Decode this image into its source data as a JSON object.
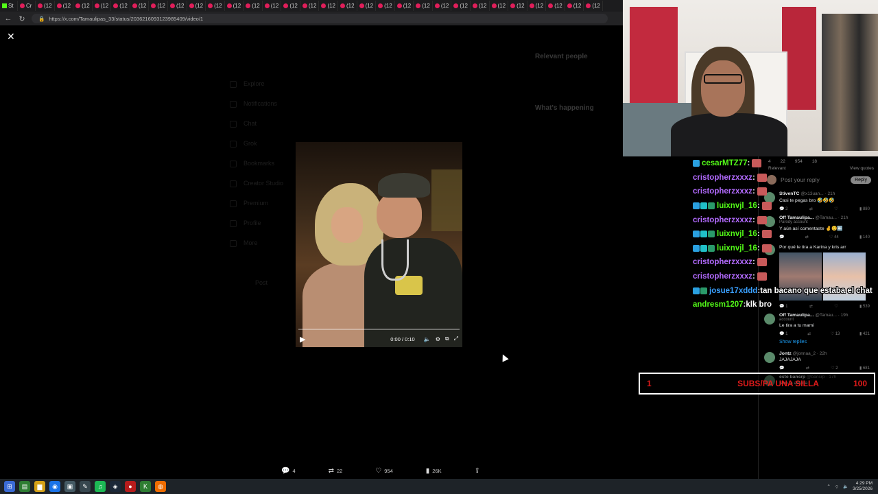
{
  "browser": {
    "tab_labels": [
      "St",
      "Cr",
      "(12",
      "(12",
      "(12",
      "(12",
      "(12",
      "(12",
      "(12",
      "(12",
      "(12",
      "(12",
      "(12",
      "(12",
      "(12",
      "(12",
      "(12",
      "(12",
      "(12",
      "(12",
      "(12",
      "(12",
      "(12",
      "(12",
      "(12",
      "(12",
      "(12",
      "(12",
      "(12",
      "(12",
      "(12",
      "(12"
    ],
    "url": "https://x.com/Tamaulipas_33/status/2036216093123985409/video/1"
  },
  "twitter_nav": {
    "items": [
      "Explore",
      "Notifications",
      "Chat",
      "Grok",
      "Bookmarks",
      "Creator Studio",
      "Premium",
      "Profile",
      "More"
    ],
    "post_button": "Post"
  },
  "video": {
    "time": "0:00 / 0:10"
  },
  "actions": {
    "replies": "4",
    "reposts": "22",
    "likes": "954",
    "views": "26K"
  },
  "replies_panel": {
    "top_stats": [
      "4",
      "22",
      "954",
      "18"
    ],
    "relevant": "Relevant",
    "view_quotes": "View quotes",
    "post_placeholder": "Post your reply",
    "reply_button": "Reply",
    "tweets": [
      {
        "name": "StivenTC",
        "handle": "@x13uan... · 21h",
        "sub": "",
        "text": "Casi te pegas bro 🤣🤣🤣",
        "stats": [
          "2",
          "",
          "",
          "880"
        ]
      },
      {
        "name": "Off Tamaulipa...",
        "handle": "@Tamau... · 21h",
        "sub": "Parody account",
        "text": "Y aún así comentaste ✌️😊⬅️",
        "stats": [
          "",
          "",
          "44",
          "140"
        ]
      },
      {
        "name": "",
        "handle": "",
        "sub": "",
        "text": "Por qué le tira a Karina y kris arr",
        "stats": [
          "1",
          "",
          "",
          "539"
        ],
        "media": true
      },
      {
        "name": "Off Tamaulipa...",
        "handle": "@Tamau... · 19h",
        "sub": "account",
        "text": "Le tira a tu mami",
        "stats": [
          "1",
          "",
          "13",
          "421"
        ]
      }
    ],
    "show_replies": "Show replies",
    "tweets2": [
      {
        "name": "Jontz",
        "handle": "@jonnaa_2 · 22h",
        "text": "JAJAJAJA",
        "stats": [
          "",
          "",
          "2",
          "681"
        ]
      },
      {
        "name": "este bansrp",
        "handle": "@bansrp · 17h",
        "text": "Noo la azulita",
        "stats": []
      }
    ]
  },
  "chat": [
    {
      "user": "cesarMTZ77",
      "color": "#53fc18",
      "badges": [
        "b-blue"
      ],
      "message": "",
      "emote": true
    },
    {
      "user": "cristopherzxxxz",
      "color": "#b36bff",
      "badges": [],
      "message": "",
      "emote": true
    },
    {
      "user": "cristopherzxxxz",
      "color": "#b36bff",
      "badges": [],
      "message": "",
      "emote": true
    },
    {
      "user": "luixnvjl_16",
      "color": "#53fc18",
      "badges": [
        "b-blue",
        "b-cyan",
        "b-green"
      ],
      "message": "",
      "emote": true
    },
    {
      "user": "cristopherzxxxz",
      "color": "#b36bff",
      "badges": [],
      "message": "",
      "emote": true
    },
    {
      "user": "luixnvjl_16",
      "color": "#53fc18",
      "badges": [
        "b-blue",
        "b-cyan",
        "b-green"
      ],
      "message": "",
      "emote": true
    },
    {
      "user": "luixnvjl_16",
      "color": "#53fc18",
      "badges": [
        "b-blue",
        "b-cyan",
        "b-green"
      ],
      "message": "",
      "emote": true
    },
    {
      "user": "cristopherzxxxz",
      "color": "#b36bff",
      "badges": [],
      "message": "",
      "emote": true
    },
    {
      "user": "cristopherzxxxz",
      "color": "#b36bff",
      "badges": [],
      "message": "",
      "emote": true
    },
    {
      "user": "josue17xddd",
      "color": "#3aa0ff",
      "badges": [
        "b-blue",
        "b-green"
      ],
      "message": "tan bacano que estaba el chat",
      "emote": false
    },
    {
      "user": "andresm1207",
      "color": "#53fc18",
      "badges": [],
      "message": "klk bro",
      "emote": false
    }
  ],
  "sub_goal": {
    "current": "1",
    "label": "SUBS/PA UNA SILLA",
    "target": "100"
  },
  "taskbar": {
    "time": "4:29 PM",
    "date": "3/25/2026"
  }
}
